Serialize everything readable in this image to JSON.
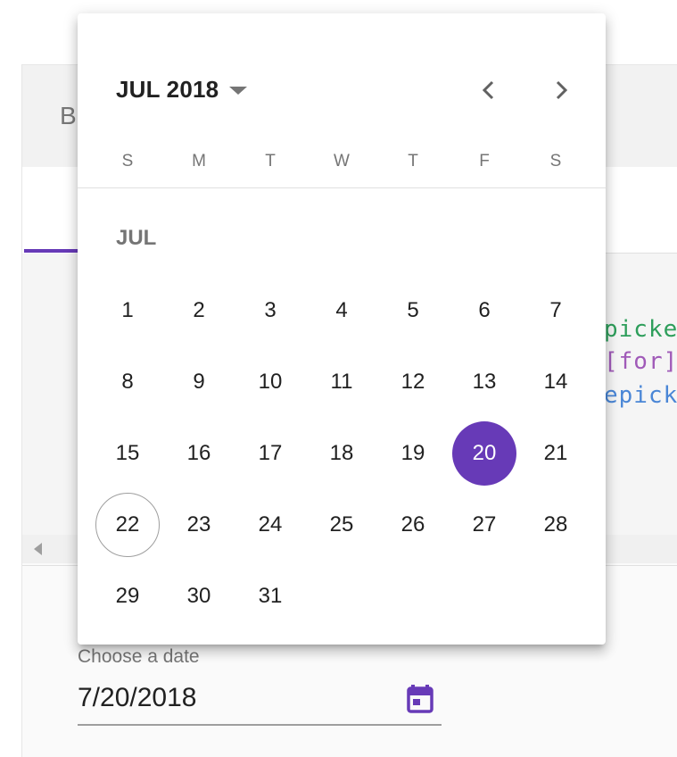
{
  "background": {
    "header_letter": "B",
    "code_lines": [
      {
        "text": "picke",
        "color": "#2e9e5b"
      },
      {
        "text": "[for]",
        "color": "#a05ab8"
      },
      {
        "text": "epick",
        "color": "#4a86d6"
      }
    ]
  },
  "datepicker": {
    "period_label": "JUL 2018",
    "prev_icon": "chevron-left-icon",
    "next_icon": "chevron-right-icon",
    "weekdays": [
      "S",
      "M",
      "T",
      "W",
      "T",
      "F",
      "S"
    ],
    "month_label": "JUL",
    "first_weekday_index": 0,
    "days": [
      "1",
      "2",
      "3",
      "4",
      "5",
      "6",
      "7",
      "8",
      "9",
      "10",
      "11",
      "12",
      "13",
      "14",
      "15",
      "16",
      "17",
      "18",
      "19",
      "20",
      "21",
      "22",
      "23",
      "24",
      "25",
      "26",
      "27",
      "28",
      "29",
      "30",
      "31"
    ],
    "selected_day": "20",
    "today_day": "22",
    "accent_color": "#673ab7"
  },
  "date_field": {
    "label": "Choose a date",
    "value": "7/20/2018",
    "toggle_icon": "calendar-icon"
  }
}
